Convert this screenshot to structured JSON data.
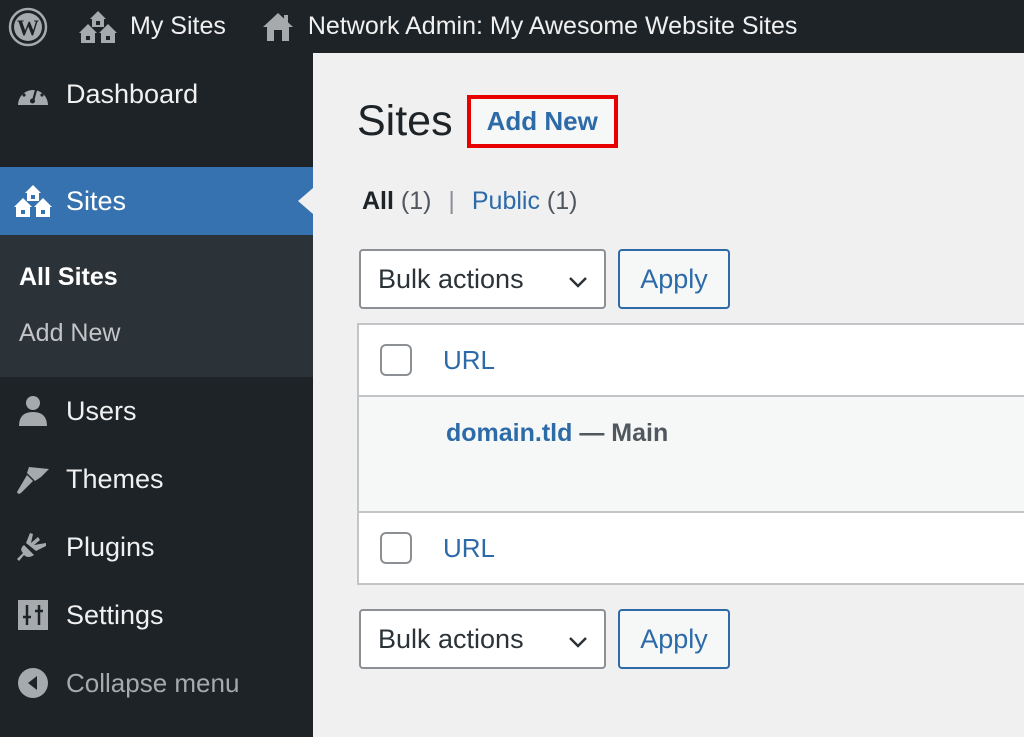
{
  "adminbar": {
    "logo_icon": "wordpress-logo-icon",
    "my_sites_label": "My Sites",
    "my_sites_icon": "multisite-icon",
    "network_label": "Network Admin: My Awesome Website Sites",
    "network_icon": "home-icon"
  },
  "sidebar": {
    "items": [
      {
        "label": "Dashboard",
        "icon": "dashboard-icon"
      },
      {
        "label": "Sites",
        "icon": "multisite-icon",
        "current": true
      },
      {
        "label": "Users",
        "icon": "users-icon"
      },
      {
        "label": "Themes",
        "icon": "brush-icon"
      },
      {
        "label": "Plugins",
        "icon": "plugin-icon"
      },
      {
        "label": "Settings",
        "icon": "settings-icon"
      },
      {
        "label": "Collapse menu",
        "icon": "collapse-icon"
      }
    ],
    "submenu": [
      {
        "label": "All Sites",
        "current": true
      },
      {
        "label": "Add New"
      }
    ]
  },
  "page": {
    "title": "Sites",
    "add_new_label": "Add New",
    "highlight_color": "#e80000"
  },
  "filters": {
    "all_label": "All",
    "all_count": "(1)",
    "separator": "|",
    "public_label": "Public",
    "public_count": "(1)"
  },
  "bulk": {
    "select_value": "Bulk actions",
    "apply_label": "Apply"
  },
  "table": {
    "column_header": "URL",
    "rows": [
      {
        "url": "domain.tld",
        "suffix": " — Main"
      }
    ]
  },
  "colors": {
    "accent": "#2d6ba8",
    "menu_current_bg": "#3672b0",
    "sidebar_bg": "#1d2327",
    "submenu_bg": "#2c3338"
  }
}
